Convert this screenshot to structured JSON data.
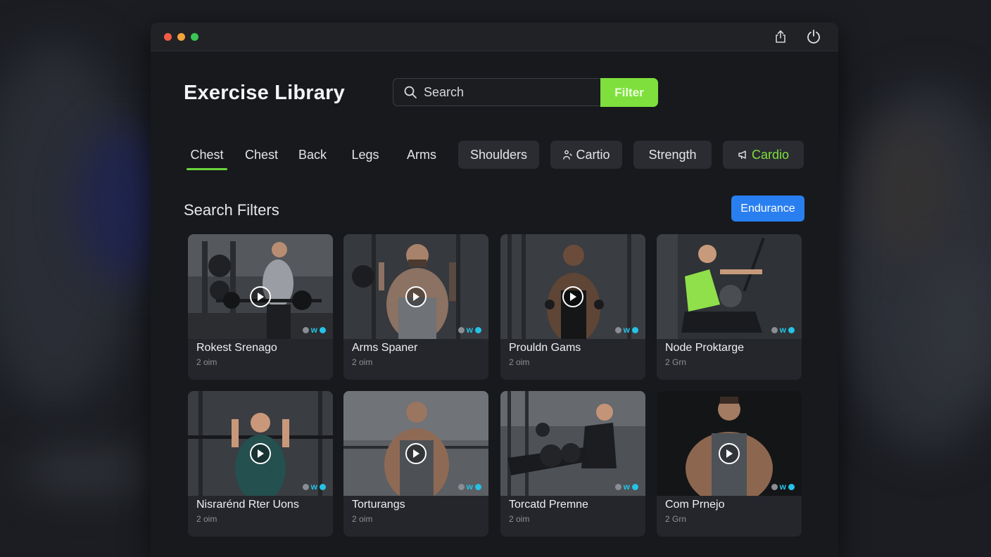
{
  "title": "Exercise Library",
  "search": {
    "placeholder": "Search",
    "button": "Filter"
  },
  "tabs": [
    {
      "label": "Chest",
      "active": true
    },
    {
      "label": "Chest"
    },
    {
      "label": "Back"
    },
    {
      "label": "Legs"
    },
    {
      "label": "Arms"
    },
    {
      "label": "Shoulders"
    },
    {
      "label": "Cartio",
      "icon": "person-icon"
    },
    {
      "label": "Strength"
    },
    {
      "label": "Cardio",
      "icon": "megaphone-icon"
    }
  ],
  "section": {
    "title": "Search Filters",
    "button": "Endurance"
  },
  "exercises": [
    {
      "title": "Rokest Srenago",
      "meta": "2 oim"
    },
    {
      "title": "Arms Spaner",
      "meta": "2 oim"
    },
    {
      "title": "Prouldn Gams",
      "meta": "2 oim"
    },
    {
      "title": "Node Proktarge",
      "meta": "2 Grn"
    },
    {
      "title": "Nisrarénd Rter Uons",
      "meta": "2 oim"
    },
    {
      "title": "Torturangs",
      "meta": "2 oim"
    },
    {
      "title": "Torcatd Premne",
      "meta": "2 oim"
    },
    {
      "title": "Com Prnejo",
      "meta": "2 Grn"
    }
  ],
  "badge_text": "w",
  "colors": {
    "accent_green": "#7fe03d",
    "accent_blue": "#2a7ff0",
    "badge_cyan": "#25c2e6"
  }
}
